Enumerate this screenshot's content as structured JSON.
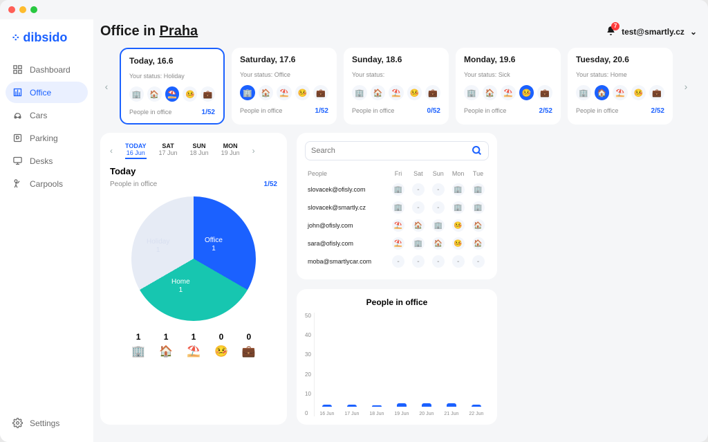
{
  "brand": "dibsido",
  "header": {
    "title_prefix": "Office in ",
    "city": "Praha",
    "user": "test@smartly.cz",
    "notifications": "7"
  },
  "sidebar": {
    "items": [
      {
        "label": "Dashboard"
      },
      {
        "label": "Office"
      },
      {
        "label": "Cars"
      },
      {
        "label": "Parking"
      },
      {
        "label": "Desks"
      },
      {
        "label": "Carpools"
      }
    ],
    "settings": "Settings"
  },
  "status_types": [
    "🏢",
    "🏠",
    "⛱️",
    "🤒",
    "💼"
  ],
  "days": [
    {
      "title": "Today, 16.6",
      "status": "Your status: Holiday",
      "active_type": 2,
      "count": "1/52",
      "active": true
    },
    {
      "title": "Saturday, 17.6",
      "status": "Your status: Office",
      "active_type": 0,
      "count": "1/52"
    },
    {
      "title": "Sunday, 18.6",
      "status": "Your status:",
      "active_type": -1,
      "count": "0/52"
    },
    {
      "title": "Monday, 19.6",
      "status": "Your status: Sick",
      "active_type": 3,
      "count": "2/52"
    },
    {
      "title": "Tuesday, 20.6",
      "status": "Your status: Home",
      "active_type": 1,
      "count": "2/52"
    }
  ],
  "people_label": "People in office",
  "tabs": [
    {
      "lbl": "TODAY",
      "dt": "16 Jun",
      "active": true
    },
    {
      "lbl": "SAT",
      "dt": "17 Jun"
    },
    {
      "lbl": "SUN",
      "dt": "18 Jun"
    },
    {
      "lbl": "MON",
      "dt": "19 Jun"
    }
  ],
  "today": {
    "title": "Today",
    "count": "1/52",
    "pie": {
      "office": {
        "label": "Office",
        "n": "1"
      },
      "home": {
        "label": "Home",
        "n": "1"
      },
      "holiday": {
        "label": "Holiday",
        "n": "1"
      }
    },
    "counts": [
      {
        "n": "1",
        "e": "🏢"
      },
      {
        "n": "1",
        "e": "🏠"
      },
      {
        "n": "1",
        "e": "⛱️"
      },
      {
        "n": "0",
        "e": "🤒"
      },
      {
        "n": "0",
        "e": "💼"
      }
    ]
  },
  "search": {
    "placeholder": "Search"
  },
  "table": {
    "head": [
      "People",
      "Fri",
      "Sat",
      "Sun",
      "Mon",
      "Tue"
    ],
    "rows": [
      {
        "p": "slovacek@ofisly.com",
        "d": [
          "🏢",
          "-",
          "-",
          "🏢",
          "🏢"
        ]
      },
      {
        "p": "slovacek@smartly.cz",
        "d": [
          "🏢",
          "-",
          "-",
          "🏢",
          "🏢"
        ]
      },
      {
        "p": "john@ofisly.com",
        "d": [
          "⛱️",
          "🏠",
          "🏢",
          "🤒",
          "🏠"
        ]
      },
      {
        "p": "sara@ofisly.com",
        "d": [
          "⛱️",
          "🏢",
          "🏠",
          "🤒",
          "🏠"
        ]
      },
      {
        "p": "moba@smartlycar.com",
        "d": [
          "-",
          "-",
          "-",
          "-",
          "-"
        ]
      }
    ]
  },
  "chart_data": {
    "type": "bar",
    "title": "People in office",
    "categories": [
      "16 Jun",
      "17 Jun",
      "18 Jun",
      "19 Jun",
      "20 Jun",
      "21 Jun",
      "22 Jun"
    ],
    "values": [
      1,
      1,
      0,
      2,
      2,
      2,
      1
    ],
    "ylabel": "",
    "xlabel": "",
    "ylim": [
      0,
      50
    ],
    "yticks": [
      50,
      40,
      30,
      20,
      10,
      0
    ]
  }
}
